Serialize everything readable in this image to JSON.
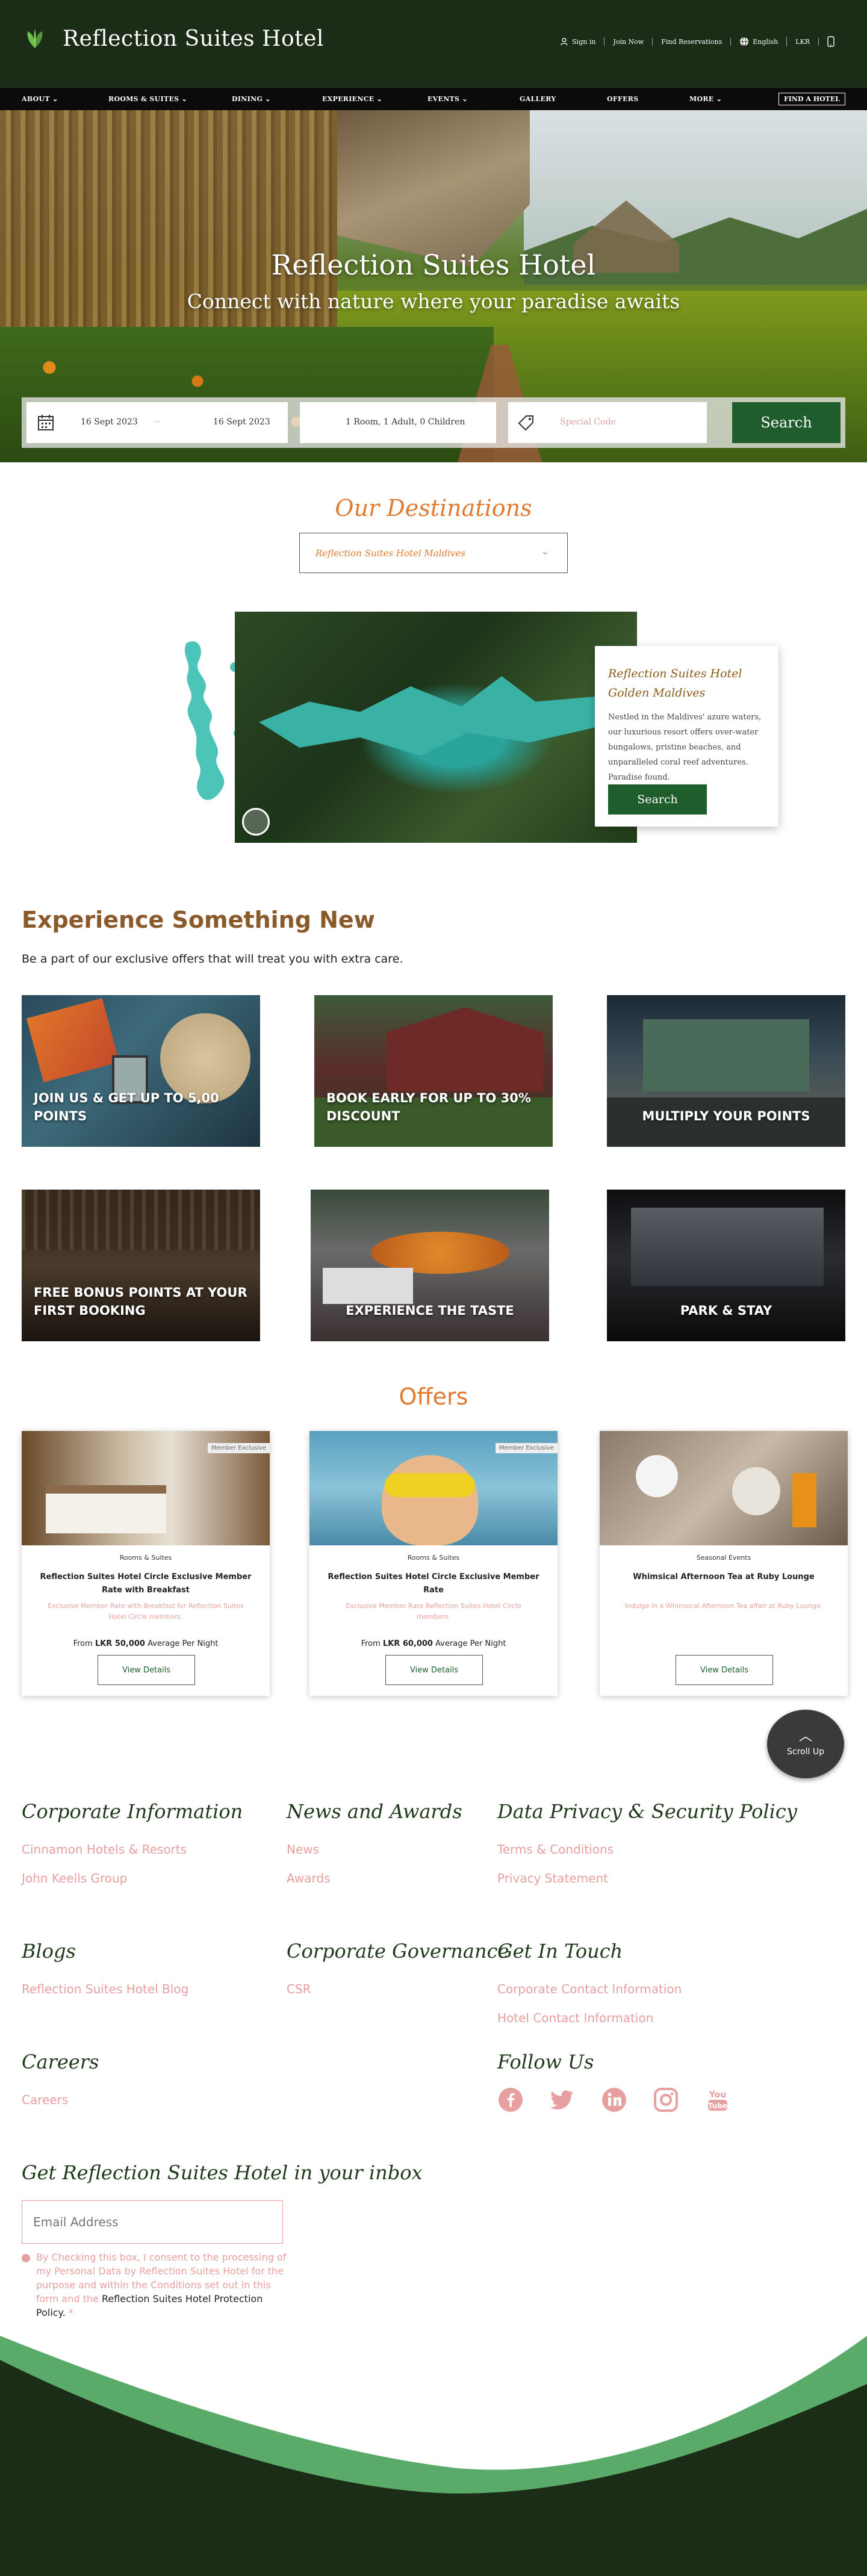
{
  "header": {
    "brand": "Reflection Suites Hotel",
    "top_links": {
      "sign_in": "Sign in",
      "join_now": "Join Now",
      "find_reservations": "Find Reservations",
      "language": "English",
      "currency": "LKR"
    }
  },
  "nav": {
    "items": [
      "ABOUT",
      "ROOMS & SUITES",
      "DINING",
      "EXPERIENCE",
      "EVENTS",
      "GALLERY",
      "OFFERS",
      "MORE"
    ],
    "find_hotel": "FIND A HOTEL"
  },
  "hero": {
    "title": "Reflection Suites Hotel",
    "subtitle": "Connect with nature where your paradise awaits"
  },
  "booking": {
    "check_in": "16 Sept 2023",
    "check_out": "16 Sept 2023",
    "guests": "1 Room, 1 Adult, 0 Children",
    "code_placeholder": "Special Code",
    "search": "Search"
  },
  "destinations": {
    "title": "Our Destinations",
    "selected": "Reflection Suites Hotel Maldives",
    "card_name": "Reflection Suites Hotel Golden Maldives",
    "card_desc": "Nestled in the Maldives' azure waters, our luxurious resort offers over-water bungalows, pristine beaches, and unparalleled coral reef adventures. Paradise found.",
    "card_button": "Search",
    "colors": {
      "lake": "#2aa39a",
      "map": "#4cc5b8"
    }
  },
  "experience": {
    "title": "Experience Something New",
    "subtitle": "Be a part of our exclusive offers that will treat you with extra care.",
    "tiles": [
      "JOIN US & GET UP TO 5,00 POINTS",
      "BOOK EARLY FOR UP TO 30% DISCOUNT",
      "MULTIPLY YOUR POINTS",
      "FREE BONUS POINTS AT YOUR FIRST BOOKING",
      "EXPERIENCE THE TASTE",
      "PARK & STAY"
    ]
  },
  "offers": {
    "title": "Offers",
    "cards": [
      {
        "tag": "Member Exclusive",
        "category": "Rooms & Suites",
        "title": "Reflection Suites Hotel Circle Exclusive Member Rate with Breakfast",
        "desc": "Exclusive Member Rate with Breakfast for Reflection Suites Hotel Circle members.",
        "price_from": "From",
        "price_amount": "LKR 50,000",
        "price_suffix": "Average Per Night",
        "button": "View Details"
      },
      {
        "tag": "Member Exclusive",
        "category": "Rooms & Suites",
        "title": "Reflection Suites Hotel Circle Exclusive Member Rate",
        "desc": "Exclusive Member Rate Reflection Suites Hotel Circle members.",
        "price_from": "From",
        "price_amount": "LKR 60,000",
        "price_suffix": "Average Per Night",
        "button": "View Details"
      },
      {
        "tag": "",
        "category": "Seasonal Events",
        "title": "Whimsical Afternoon Tea at Ruby Lounge",
        "desc": "Indulge in a Whimsical Afternoon Tea affair at Ruby Lounge.",
        "price_from": "",
        "price_amount": "",
        "price_suffix": "",
        "button": "View Details"
      }
    ]
  },
  "scroll_up": "Scroll Up",
  "footer": {
    "corporate": {
      "title": "Corporate Information",
      "links": [
        "Cinnamon Hotels & Resorts",
        "John Keells Group"
      ]
    },
    "news": {
      "title": "News and Awards",
      "links": [
        "News",
        "Awards"
      ]
    },
    "privacy": {
      "title": "Data Privacy & Security Policy",
      "links": [
        "Terms & Conditions",
        "Privacy Statement"
      ]
    },
    "blogs": {
      "title": "Blogs",
      "links": [
        "Reflection Suites Hotel Blog"
      ]
    },
    "governance": {
      "title": "Corporate Governance",
      "links": [
        "CSR"
      ]
    },
    "contact": {
      "title": "Get In Touch",
      "links": [
        "Corporate Contact Information",
        "Hotel Contact Information"
      ]
    },
    "careers": {
      "title": "Careers",
      "links": [
        "Careers"
      ]
    },
    "follow": {
      "title": "Follow Us",
      "icons": [
        "facebook-icon",
        "twitter-icon",
        "linkedin-icon",
        "instagram-icon",
        "youtube-icon"
      ]
    },
    "newsletter": {
      "title": "Get Reflection Suites Hotel in your inbox",
      "email_placeholder": "Email Address",
      "consent": "By Checking this box, I consent to the processing of my Personal Data by Reflection Suites Hotel for the purpose and within the Conditions set out in this form and the",
      "policy": "Reflection Suites Hotel Protection Policy.",
      "asterisk": "*"
    },
    "colors": {
      "dark": "#1b2c17",
      "accent": "#5aaa6a"
    }
  }
}
